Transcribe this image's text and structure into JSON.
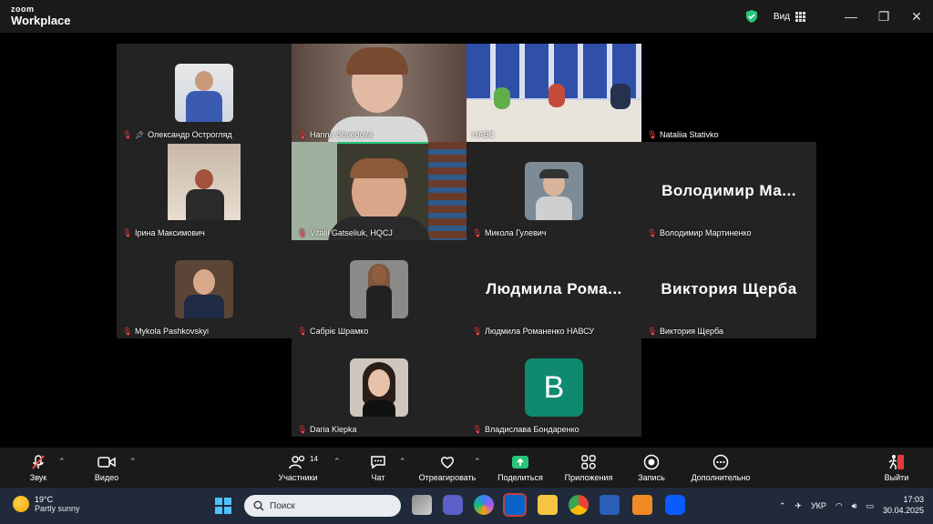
{
  "app": {
    "brand_top": "zoom",
    "brand_bottom": "Workplace",
    "view_label": "Вид"
  },
  "colors": {
    "speaking_border": "#27c57a",
    "muted_mic": "#ff4d4d",
    "avatar_bg": "#0f8a6e"
  },
  "participants": [
    {
      "name": "Олександр Острогляд",
      "pinned": true
    },
    {
      "name": "Hanna Shvedova"
    },
    {
      "name": "НАВС"
    },
    {
      "name": "Nataliia Stativko"
    },
    {
      "name": "Ірина Максимович"
    },
    {
      "name": "Vitalii Gatseliuk, HQCJ"
    },
    {
      "name": "Микола Гулевич"
    },
    {
      "name": "Володимир Мартиненко",
      "display": "Володимир Ма..."
    },
    {
      "name": "Mykola Pashkovskyi"
    },
    {
      "name": "Сабріє Шрамко"
    },
    {
      "name": "Людмила Романенко НАВСУ",
      "display": "Людмила Рома..."
    },
    {
      "name": "Виктория Щерба",
      "display": "Виктория Щерба"
    },
    {
      "name": "Daria Klepka"
    },
    {
      "name": "Владислава Бондаренко",
      "avatar_letter": "B"
    }
  ],
  "toolbar": {
    "audio": "Звук",
    "video": "Видео",
    "participants": "Участники",
    "participants_count": "14",
    "chat": "Чат",
    "react": "Отреагировать",
    "share": "Поделиться",
    "apps": "Приложения",
    "record": "Запись",
    "more": "Дополнительно",
    "leave": "Выйти"
  },
  "taskbar": {
    "temp": "19°C",
    "weather": "Partly sunny",
    "search_placeholder": "Поиск",
    "lang": "УКР",
    "time": "17:03",
    "date": "30.04.2025"
  }
}
